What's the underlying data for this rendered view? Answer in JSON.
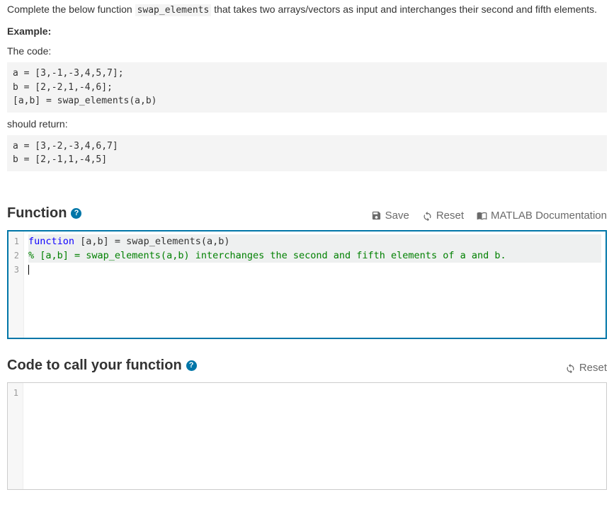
{
  "problem": {
    "description_pre": "Complete the below function ",
    "func_name": "swap_elements",
    "description_post": " that takes two arrays/vectors as input and interchanges their second and fifth elements.",
    "example_label": "Example:",
    "the_code_label": "The code:",
    "code_example": "a = [3,-1,-3,4,5,7];\nb = [2,-2,1,-4,6];\n[a,b] = swap_elements(a,b)",
    "should_return_label": "should return:",
    "result_example": "a = [3,-2,-3,4,6,7]\nb = [2,-1,1,-4,5]"
  },
  "sections": {
    "function": {
      "title": "Function",
      "toolbar": {
        "save": "Save",
        "reset": "Reset",
        "docs": "MATLAB Documentation"
      },
      "lines": {
        "l1_kw": "function",
        "l1_rest": " [a,b] = swap_elements(a,b)",
        "l2": "% [a,b] = swap_elements(a,b) interchanges the second and fifth elements of a and b."
      },
      "gutter": [
        "1",
        "2",
        "3"
      ]
    },
    "caller": {
      "title": "Code to call your function",
      "toolbar": {
        "reset": "Reset"
      },
      "gutter": [
        "1"
      ]
    }
  },
  "icons": {
    "help": "?"
  }
}
